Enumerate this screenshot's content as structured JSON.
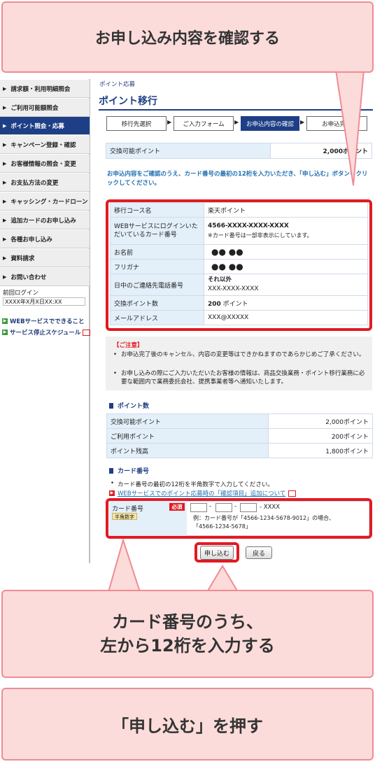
{
  "callouts": {
    "top": "お申し込み内容を確認する",
    "middle_line1": "カード番号のうち、",
    "middle_line2": "左から12桁を入力する",
    "bottom": "「申し込む」を押す"
  },
  "sidebar": {
    "items": [
      {
        "label": "請求額・利用明細照会"
      },
      {
        "label": "ご利用可能額照会"
      },
      {
        "label": "ポイント照会・応募"
      },
      {
        "label": "キャンペーン登録・確認"
      },
      {
        "label": "お客様情報の照会・変更"
      },
      {
        "label": "お支払方法の変更"
      },
      {
        "label": "キャッシング・カードローン"
      },
      {
        "label": "追加カードのお申し込み"
      },
      {
        "label": "各種お申し込み"
      },
      {
        "label": "資料請求"
      },
      {
        "label": "お問い合わせ"
      }
    ],
    "last_login_label": "前回ログイン",
    "last_login_value": "XXXX年X月X日XX:XX",
    "link1": "WEBサービスでできること",
    "link2": "サービス停止スケジュール"
  },
  "header": {
    "breadcrumb": "ポイント応募",
    "title": "ポイント移行"
  },
  "steps": [
    "移行先選択",
    "ご入力フォーム",
    "お申込内容の確認",
    "お申込完了"
  ],
  "exchangeable": {
    "label": "交換可能ポイント",
    "value": "2,000ポイント"
  },
  "instruction": "お申込内容をご確認のうえ、カード番号の最初の12桁を入力いただき、「申し込む」ボタンをクリックしてください。",
  "details": {
    "rows": [
      {
        "label": "移行コース名",
        "value": "楽天ポイント",
        "sub": ""
      },
      {
        "label1": "WEBサービスにログインいた",
        "label2": "だいているカード番号",
        "value": "4566-XXXX-XXXX-XXXX",
        "sub": "※カード番号は一部非表示にしています。"
      },
      {
        "label": "お名前",
        "value": "●●  ●●",
        "sub": ""
      },
      {
        "label": "フリガナ",
        "value": "●●  ●●",
        "sub": ""
      },
      {
        "label": "日中のご連絡先電話番号",
        "value": "それ以外",
        "sub": "XXX-XXXX-XXXX"
      },
      {
        "label": "交換ポイント数",
        "value": "200",
        "unit": "ポイント"
      },
      {
        "label": "メールアドレス",
        "value": "XXX@XXXXX",
        "sub": ""
      }
    ]
  },
  "notice": {
    "title": "【ご注意】",
    "item1": "お申込完了後のキャンセル、内容の変更等はできかねますのであらかじめご了承ください。",
    "item2": "お申し込みの際にご入力いただいたお客様の情報は、商品交換業務・ポイント移行業務に必要な範囲内で業務委託会社、提携事業者等へ通知いたします。"
  },
  "points": {
    "heading": "ポイント数",
    "rows": [
      {
        "label": "交換可能ポイント",
        "value": "2,000ポイント"
      },
      {
        "label": "ご利用ポイント",
        "value": "200ポイント"
      },
      {
        "label": "ポイント残高",
        "value": "1,800ポイント"
      }
    ]
  },
  "card": {
    "heading": "カード番号",
    "bullet": "カード番号の最初の12桁を半角数字で入力してください。",
    "link": "WEBサービスでのポイント応募時の「確認項目」追加について",
    "field_label": "カード番号",
    "required": "必須",
    "halfwidth": "半角数字",
    "dash": "-",
    "tail": "- XXXX",
    "example1": "例：カード番号が「4566-1234-5678-9012」の場合、",
    "example2": "「4566-1234-5678」"
  },
  "buttons": {
    "submit": "申し込む",
    "back": "戻る"
  },
  "colors": {
    "accent": "#1e3f86",
    "callout_bg": "#fbdcdb",
    "highlight": "#e21a22",
    "link": "#1f6fb2"
  }
}
